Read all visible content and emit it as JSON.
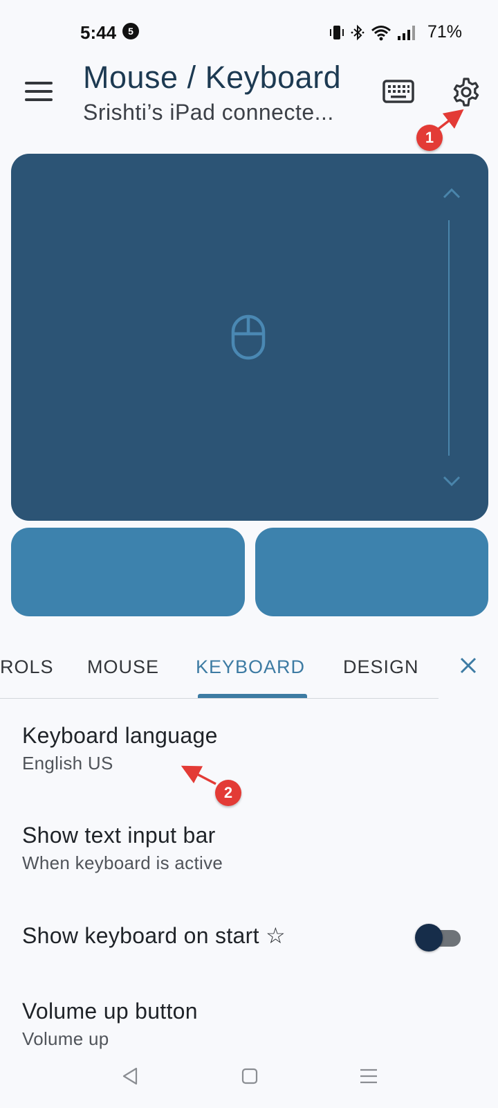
{
  "status_bar": {
    "time": "5:44",
    "notification_count": "5",
    "battery": "71%",
    "icons": [
      "vibrate-icon",
      "bluetooth-icon",
      "wifi-icon",
      "signal-icon"
    ]
  },
  "app_bar": {
    "title": "Mouse / Keyboard",
    "subtitle": "Srishti’s iPad connecte...",
    "icons": [
      "menu-icon",
      "keyboard-icon",
      "gear-icon"
    ]
  },
  "annotations": {
    "callout_1": "1",
    "callout_2": "2"
  },
  "touchpad": {
    "icons": [
      "mouse-icon",
      "chevron-up-icon",
      "chevron-down-icon"
    ]
  },
  "tabs": [
    {
      "label": "ROLS",
      "active": false
    },
    {
      "label": "MOUSE",
      "active": false
    },
    {
      "label": "KEYBOARD",
      "active": true
    },
    {
      "label": "DESIGN",
      "active": false
    }
  ],
  "settings": [
    {
      "title": "Keyboard language",
      "summary": "English US"
    },
    {
      "title": "Show text input bar",
      "summary": "When keyboard is active"
    },
    {
      "title": "Show keyboard on start ☆",
      "toggle_on": false
    },
    {
      "title": "Volume up button",
      "summary": "Volume up"
    }
  ],
  "colors": {
    "touchpad": "#2c5475",
    "mouse_buttons": "#3d82ad",
    "accent": "#3d7ba3",
    "callout": "#e33b36",
    "background": "#f8f9fc"
  }
}
